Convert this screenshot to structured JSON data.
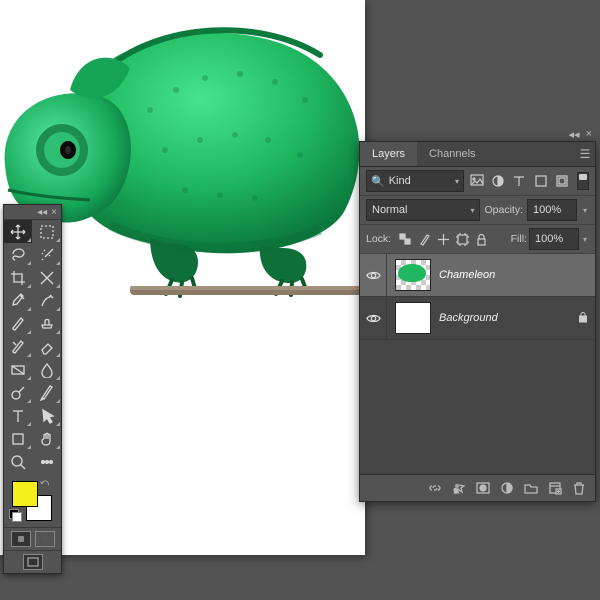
{
  "panel": {
    "tabs": {
      "layers": "Layers",
      "channels": "Channels"
    },
    "filter_kind": "Kind",
    "blend_mode": "Normal",
    "opacity_label": "Opacity:",
    "opacity_value": "100%",
    "lock_label": "Lock:",
    "fill_label": "Fill:",
    "fill_value": "100%"
  },
  "layers": [
    {
      "name": "Chameleon",
      "selected": true,
      "italic": true,
      "locked": false,
      "thumb": "subject"
    },
    {
      "name": "Background",
      "selected": false,
      "italic": true,
      "locked": true,
      "thumb": "white"
    }
  ],
  "swatches": {
    "fg": "#f5ef1c",
    "bg": "#ffffff"
  },
  "subject_color": "#1fb860"
}
